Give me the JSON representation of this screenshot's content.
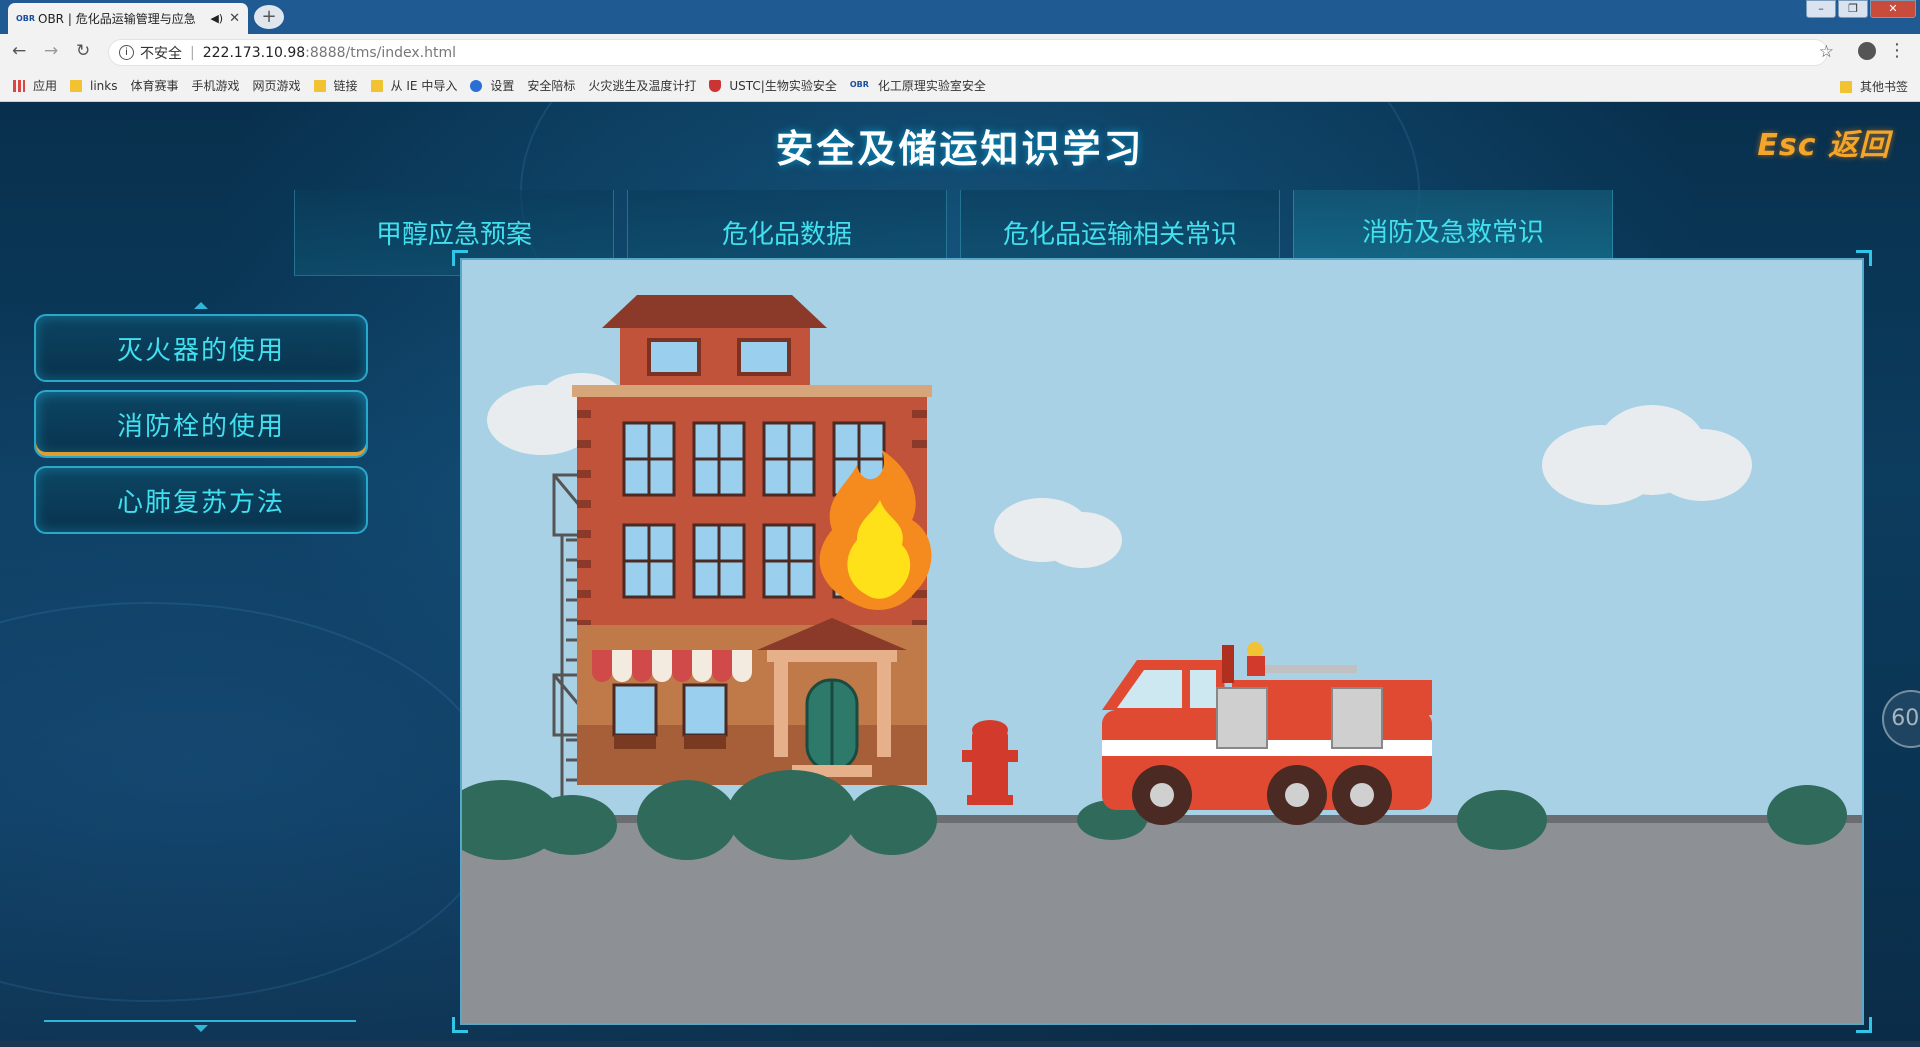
{
  "browser": {
    "tab_title": "OBR | 危化品运输管理与应急",
    "favicon_text": "OBR",
    "url_security": "不安全",
    "url_host": "222.173.10.98",
    "url_path": ":8888/tms/index.html",
    "bookmarks": [
      {
        "label": "应用",
        "icon": "apps-icon"
      },
      {
        "label": "links",
        "icon": "folder-icon"
      },
      {
        "label": "体育赛事",
        "icon": "page-icon"
      },
      {
        "label": "手机游戏",
        "icon": "page-icon"
      },
      {
        "label": "网页游戏",
        "icon": "page-icon"
      },
      {
        "label": "链接",
        "icon": "folder-icon"
      },
      {
        "label": "从 IE 中导入",
        "icon": "folder-icon"
      },
      {
        "label": "设置",
        "icon": "gear-icon"
      },
      {
        "label": "安全陪标",
        "icon": "page-icon"
      },
      {
        "label": "火灾逃生及温度计打",
        "icon": "page-icon"
      },
      {
        "label": "USTC|生物实验安全",
        "icon": "shield-icon"
      },
      {
        "label": "化工原理实验室安全",
        "icon": "obr-icon"
      }
    ],
    "other_bookmarks": "其他书签"
  },
  "header": {
    "title": "安全及储运知识学习",
    "back_label": "Esc 返回"
  },
  "tabs": [
    {
      "label": "甲醇应急预案",
      "active": false
    },
    {
      "label": "危化品数据",
      "active": false
    },
    {
      "label": "危化品运输相关常识",
      "active": false
    },
    {
      "label": "消防及急救常识",
      "active": true
    }
  ],
  "sidebar": {
    "items": [
      {
        "label": "灭火器的使用",
        "active": false
      },
      {
        "label": "消防栓的使用",
        "active": true
      },
      {
        "label": "心肺复苏方法",
        "active": false
      }
    ]
  },
  "zoom": "60",
  "zoom_unit": "%",
  "colors": {
    "accent": "#40e0ee",
    "esc": "#f5a62a",
    "sky": "#a9d1e6"
  }
}
